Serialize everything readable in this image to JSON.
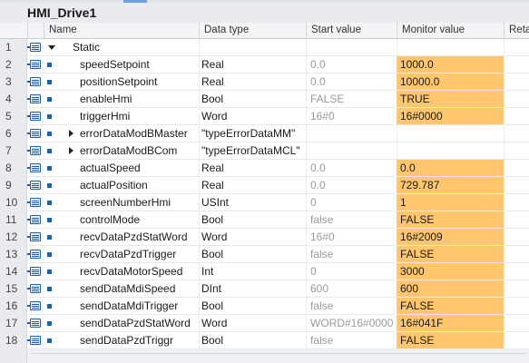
{
  "window": {
    "title": "HMI_Drive1"
  },
  "columns": {
    "name": "Name",
    "data_type": "Data type",
    "start_value": "Start value",
    "monitor_value": "Monitor value",
    "retain": "Reta"
  },
  "rows": [
    {
      "num": "1",
      "name": "Static",
      "expand": "down",
      "level": 0,
      "type": "",
      "start": "",
      "monitor": "",
      "monitor_highlight": false
    },
    {
      "num": "2",
      "name": "speedSetpoint",
      "expand": "none",
      "level": 1,
      "type": "Real",
      "start": "0.0",
      "monitor": "1000.0",
      "monitor_highlight": true
    },
    {
      "num": "3",
      "name": "positionSetpoint",
      "expand": "none",
      "level": 1,
      "type": "Real",
      "start": "0.0",
      "monitor": "10000.0",
      "monitor_highlight": true
    },
    {
      "num": "4",
      "name": "enableHmi",
      "expand": "none",
      "level": 1,
      "type": "Bool",
      "start": "FALSE",
      "monitor": "TRUE",
      "monitor_highlight": true
    },
    {
      "num": "5",
      "name": "triggerHmi",
      "expand": "none",
      "level": 1,
      "type": "Word",
      "start": "16#0",
      "monitor": "16#0000",
      "monitor_highlight": true
    },
    {
      "num": "6",
      "name": "errorDataModBMaster",
      "expand": "right",
      "level": 1,
      "type": "\"typeErrorDataMM\"",
      "start": "",
      "monitor": "",
      "monitor_highlight": false
    },
    {
      "num": "7",
      "name": "errorDataModBCom",
      "expand": "right",
      "level": 1,
      "type": "\"typeErrorDataMCL\"",
      "start": "",
      "monitor": "",
      "monitor_highlight": false
    },
    {
      "num": "8",
      "name": "actualSpeed",
      "expand": "none",
      "level": 1,
      "type": "Real",
      "start": "0.0",
      "monitor": "0.0",
      "monitor_highlight": true
    },
    {
      "num": "9",
      "name": "actualPosition",
      "expand": "none",
      "level": 1,
      "type": "Real",
      "start": "0.0",
      "monitor": "729.787",
      "monitor_highlight": true
    },
    {
      "num": "10",
      "name": "screenNumberHmi",
      "expand": "none",
      "level": 1,
      "type": "USInt",
      "start": "0",
      "monitor": "1",
      "monitor_highlight": true
    },
    {
      "num": "11",
      "name": "controlMode",
      "expand": "none",
      "level": 1,
      "type": "Bool",
      "start": "false",
      "monitor": "FALSE",
      "monitor_highlight": true
    },
    {
      "num": "12",
      "name": "recvDataPzdStatWord",
      "expand": "none",
      "level": 1,
      "type": "Word",
      "start": "16#0",
      "monitor": "16#2009",
      "monitor_highlight": true
    },
    {
      "num": "13",
      "name": "recvDataPzdTrigger",
      "expand": "none",
      "level": 1,
      "type": "Bool",
      "start": "false",
      "monitor": "FALSE",
      "monitor_highlight": true
    },
    {
      "num": "14",
      "name": "recvDataMotorSpeed",
      "expand": "none",
      "level": 1,
      "type": "Int",
      "start": "0",
      "monitor": "3000",
      "monitor_highlight": true
    },
    {
      "num": "15",
      "name": "sendDataMdiSpeed",
      "expand": "none",
      "level": 1,
      "type": "DInt",
      "start": "600",
      "monitor": "600",
      "monitor_highlight": true
    },
    {
      "num": "16",
      "name": "sendDataMdiTrigger",
      "expand": "none",
      "level": 1,
      "type": "Bool",
      "start": "false",
      "monitor": "FALSE",
      "monitor_highlight": true
    },
    {
      "num": "17",
      "name": "sendDataPzdStatWord",
      "expand": "none",
      "level": 1,
      "type": "Word",
      "start": "WORD#16#0000",
      "monitor": "16#041F",
      "monitor_highlight": true
    },
    {
      "num": "18",
      "name": "sendDataPzdTriggr",
      "expand": "none",
      "level": 1,
      "type": "Bool",
      "start": "false",
      "monitor": "FALSE",
      "monitor_highlight": true
    }
  ],
  "colors": {
    "monitor_highlight": "#ffc66e",
    "icon_blue": "#1f5fa8",
    "start_value_gray": "#9a9a9a"
  },
  "icons": {
    "row_icon": "db-interface-icon",
    "member_marker": "member-bullet-icon",
    "expanded": "triangle-down-icon",
    "collapsed": "triangle-right-icon"
  }
}
